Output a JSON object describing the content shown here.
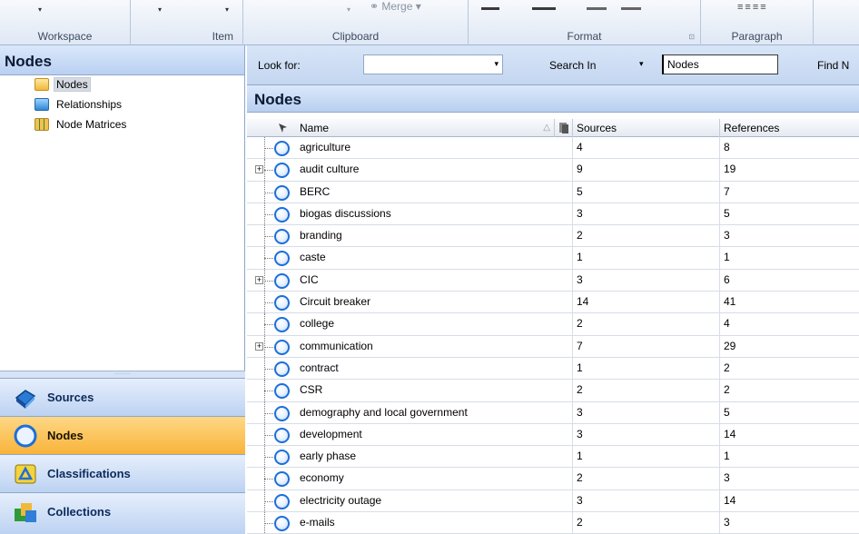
{
  "ribbon": {
    "groups": {
      "workspace": "Workspace",
      "item": "Item",
      "clipboard": "Clipboard",
      "format": "Format",
      "paragraph": "Paragraph"
    },
    "merge_label": "Merge",
    "merge_arrow": "▾",
    "dropdown_glyph": "▾",
    "launcher_glyph": "⊡",
    "align_glyph": "≡≡≡≡"
  },
  "left": {
    "header": "Nodes",
    "tree": [
      {
        "label": "Nodes",
        "icon": "folder-open-icon",
        "selected": true
      },
      {
        "label": "Relationships",
        "icon": "relationships-icon"
      },
      {
        "label": "Node Matrices",
        "icon": "node-matrices-icon"
      }
    ],
    "splitter_grip": "·········",
    "nav": [
      {
        "label": "Sources",
        "icon": "sources-book-icon"
      },
      {
        "label": "Nodes",
        "icon": "nodes-circle-icon",
        "active": true
      },
      {
        "label": "Classifications",
        "icon": "classifications-icon"
      },
      {
        "label": "Collections",
        "icon": "collections-icon"
      }
    ]
  },
  "find": {
    "look_for_label": "Look for:",
    "look_for_value": "",
    "search_in_label": "Search In",
    "search_in_value": "Nodes",
    "find_now_label": "Find N",
    "dropdown_glyph": "▾"
  },
  "list": {
    "title": "Nodes",
    "columns": {
      "name": "Name",
      "sources": "Sources",
      "references": "References"
    },
    "sort_glyph": "△",
    "plus_glyph": "+",
    "rows": [
      {
        "name": "agriculture",
        "sources": "4",
        "references": "8",
        "expandable": false
      },
      {
        "name": "audit culture",
        "sources": "9",
        "references": "19",
        "expandable": true
      },
      {
        "name": "BERC",
        "sources": "5",
        "references": "7",
        "expandable": false
      },
      {
        "name": "biogas discussions",
        "sources": "3",
        "references": "5",
        "expandable": false
      },
      {
        "name": "branding",
        "sources": "2",
        "references": "3",
        "expandable": false
      },
      {
        "name": "caste",
        "sources": "1",
        "references": "1",
        "expandable": false
      },
      {
        "name": "CIC",
        "sources": "3",
        "references": "6",
        "expandable": true
      },
      {
        "name": "Circuit breaker",
        "sources": "14",
        "references": "41",
        "expandable": false
      },
      {
        "name": "college",
        "sources": "2",
        "references": "4",
        "expandable": false
      },
      {
        "name": "communication",
        "sources": "7",
        "references": "29",
        "expandable": true
      },
      {
        "name": "contract",
        "sources": "1",
        "references": "2",
        "expandable": false
      },
      {
        "name": "CSR",
        "sources": "2",
        "references": "2",
        "expandable": false
      },
      {
        "name": "demography and local government",
        "sources": "3",
        "references": "5",
        "expandable": false
      },
      {
        "name": "development",
        "sources": "3",
        "references": "14",
        "expandable": false
      },
      {
        "name": "early phase",
        "sources": "1",
        "references": "1",
        "expandable": false
      },
      {
        "name": "economy",
        "sources": "2",
        "references": "3",
        "expandable": false
      },
      {
        "name": "electricity outage",
        "sources": "3",
        "references": "14",
        "expandable": false
      },
      {
        "name": "e-mails",
        "sources": "2",
        "references": "3",
        "expandable": false
      }
    ]
  }
}
